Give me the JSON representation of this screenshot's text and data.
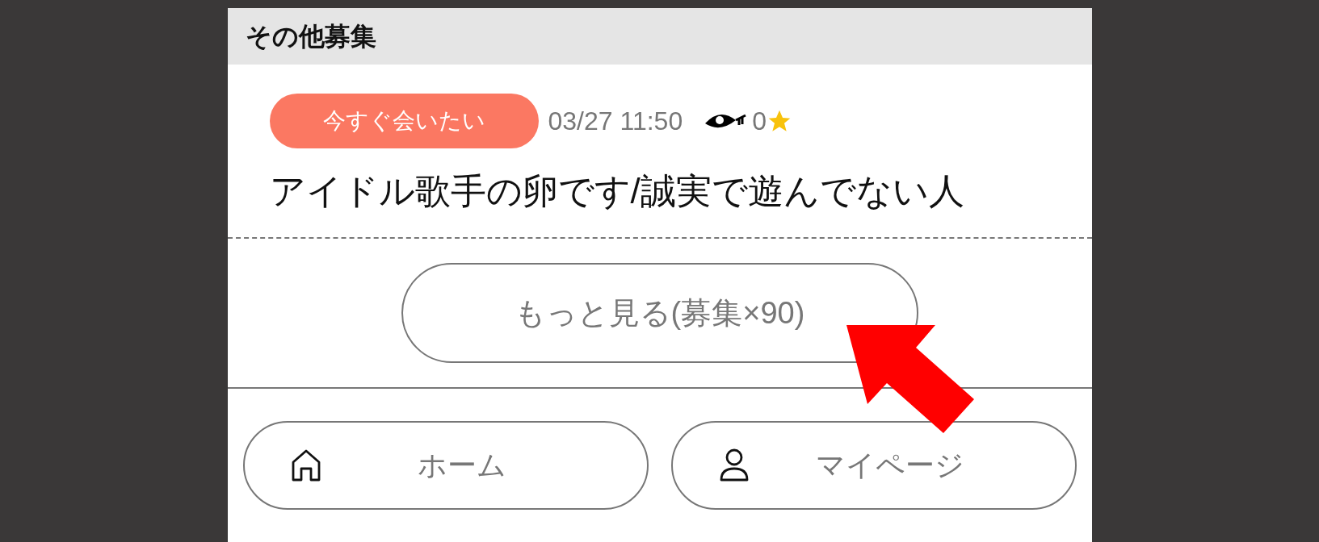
{
  "section": {
    "title": "その他募集"
  },
  "posts": [
    {
      "tag": "今すぐ会いたい",
      "color": "#fb7862",
      "time": "03/27 11:50",
      "views": "0",
      "title": "アイドル歌手の卵です/誠実で遊んでない人"
    }
  ],
  "more_button": "もっと見る(募集×90)",
  "nav": [
    {
      "kind": "home",
      "label": "ホーム"
    },
    {
      "kind": "user",
      "label": "マイページ"
    }
  ]
}
